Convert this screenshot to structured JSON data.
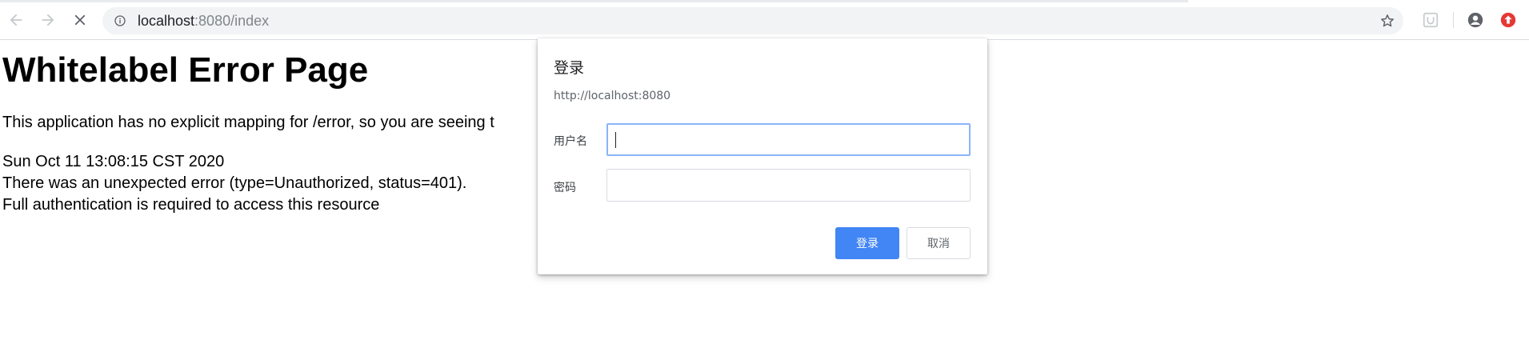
{
  "browser": {
    "url_host": "localhost",
    "url_rest": ":8080/index",
    "icons": {
      "back": "arrow-left-icon",
      "forward": "arrow-right-icon",
      "stop": "close-icon",
      "site_info": "info-icon",
      "bookmark": "star-icon",
      "extension": "extension-icon",
      "profile": "account-circle-icon",
      "update": "update-arrow-icon"
    },
    "colors": {
      "update_badge": "#e53935",
      "omnibox_bg": "#f1f3f4"
    }
  },
  "page": {
    "heading": "Whitelabel Error Page",
    "message": "This application has no explicit mapping for /error, so you are seeing t",
    "timestamp": "Sun Oct 11 13:08:15 CST 2020",
    "error_line": "There was an unexpected error (type=Unauthorized, status=401).",
    "detail": "Full authentication is required to access this resource"
  },
  "dialog": {
    "title": "登录",
    "origin": "http://localhost:8080",
    "username_label": "用户名",
    "username_value": "",
    "password_label": "密码",
    "password_value": "",
    "login_button": "登录",
    "cancel_button": "取消",
    "colors": {
      "primary": "#4285f4",
      "focus_ring": "#8ab4f8"
    }
  }
}
